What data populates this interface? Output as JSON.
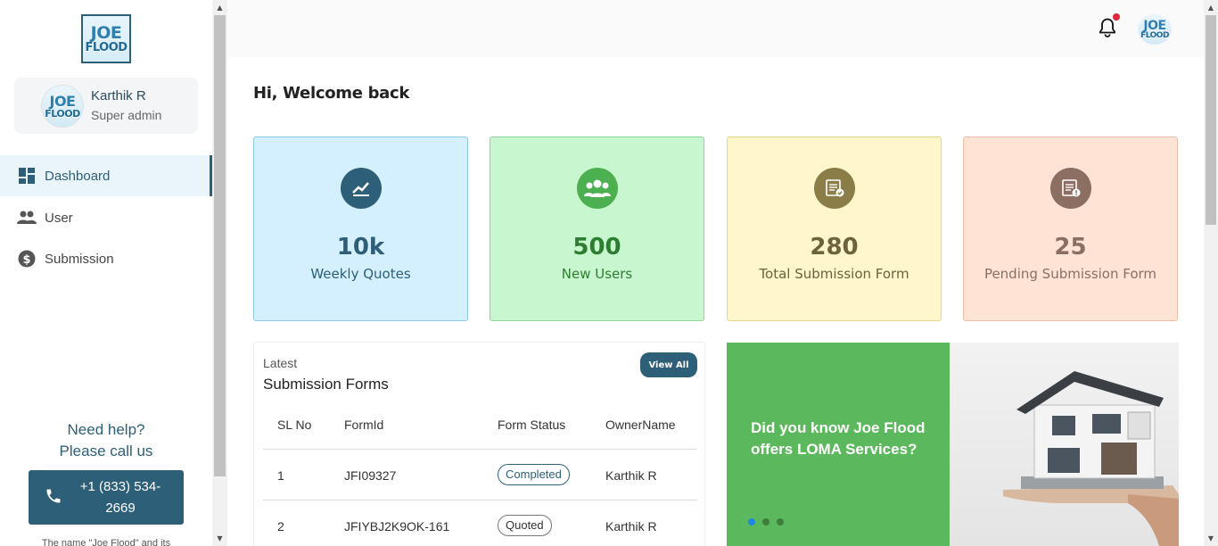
{
  "brand": {
    "logo_line1": "JOE",
    "logo_line2": "FLOOD"
  },
  "profile": {
    "name": "Karthik R",
    "role": "Super admin"
  },
  "sidebar": {
    "items": [
      {
        "label": "Dashboard",
        "icon": "dashboard-icon",
        "active": true
      },
      {
        "label": "User",
        "icon": "users-icon",
        "active": false
      },
      {
        "label": "Submission",
        "icon": "dollar-icon",
        "active": false
      }
    ],
    "help_line1": "Need help?",
    "help_line2": "Please call us",
    "phone_line1": "+1 (833) 534-",
    "phone_line2": "2669",
    "footer_note": "The name \"Joe Flood\" and its"
  },
  "header": {
    "notification_badge": true
  },
  "main": {
    "welcome": "Hi, Welcome back",
    "cards": [
      {
        "value": "10k",
        "label": "Weekly Quotes",
        "icon": "trend-chart-icon",
        "bg": "#d4effd",
        "border": "#8ecae6",
        "circle": "#2d5f78",
        "fg": "#2d5f78"
      },
      {
        "value": "500",
        "label": "New Users",
        "icon": "users-group-icon",
        "bg": "#c8f7cf",
        "border": "#8fd89a",
        "circle": "#4caf50",
        "fg": "#2e7d32"
      },
      {
        "value": "280",
        "label": "Total Submission Form",
        "icon": "form-check-icon",
        "bg": "#fff6cc",
        "border": "#e7d48a",
        "circle": "#8b7d48",
        "fg": "#6e623a"
      },
      {
        "value": "25",
        "label": "Pending Submission Form",
        "icon": "form-pending-icon",
        "bg": "#ffe4d6",
        "border": "#eebfa6",
        "circle": "#8d6e63",
        "fg": "#8d6e63"
      }
    ],
    "latest": {
      "subtitle": "Latest",
      "title": "Submission Forms",
      "view_all": "View All",
      "columns": [
        "SL No",
        "FormId",
        "Form Status",
        "OwnerName"
      ],
      "rows": [
        {
          "sl": "1",
          "form_id": "JFI09327",
          "status": "Completed",
          "owner": "Karthik R"
        },
        {
          "sl": "2",
          "form_id": "JFIYBJ2K9OK-161",
          "status": "Quoted",
          "owner": "Karthik R"
        }
      ]
    },
    "promo": {
      "text": "Did you know Joe Flood offers LOMA Services?",
      "slides": 3,
      "active_slide": 1
    }
  }
}
